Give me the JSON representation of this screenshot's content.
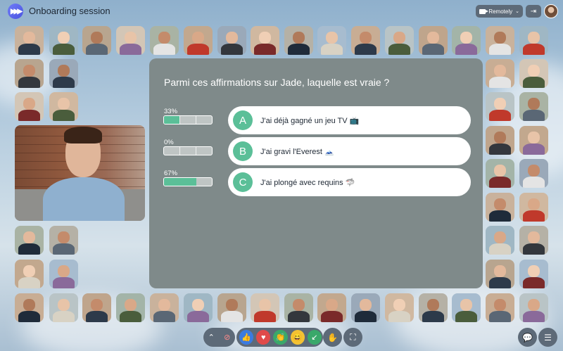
{
  "app": {
    "title": "Onboarding session",
    "logo_glyph": "▶▶▶"
  },
  "header": {
    "location_mode": "Remotely",
    "chevron": "⌄",
    "exit_glyph": "⇥"
  },
  "quiz": {
    "question": "Parmi ces affirmations sur Jade, laquelle est vraie ?",
    "answer_color": "#5bbf98",
    "options": [
      {
        "letter": "A",
        "text": "J'ai déjà gagné un jeu TV 📺",
        "percent_label": "33%",
        "percent": 33
      },
      {
        "letter": "B",
        "text": "J'ai gravi l'Everest 🗻",
        "percent_label": "0%",
        "percent": 0
      },
      {
        "letter": "C",
        "text": "J'ai plongé avec requins 🦈",
        "percent_label": "67%",
        "percent": 67
      }
    ]
  },
  "toolbar": {
    "expand_glyph": "⌃",
    "camera_off_glyph": "⊘",
    "reactions": [
      {
        "name": "thumbs-up",
        "glyph": "👍",
        "color": "#3b7be0"
      },
      {
        "name": "heart",
        "glyph": "♥",
        "color": "#e04a4a"
      },
      {
        "name": "clap",
        "glyph": "👏",
        "color": "#3aa86a"
      },
      {
        "name": "laugh",
        "glyph": "😄",
        "color": "#f3c233"
      },
      {
        "name": "arrow",
        "glyph": "↙",
        "color": "#3aa86a"
      }
    ],
    "raise_hand_glyph": "✋",
    "fullscreen_glyph": "⛶",
    "chat_glyph": "💬",
    "menu_glyph": "☰"
  }
}
